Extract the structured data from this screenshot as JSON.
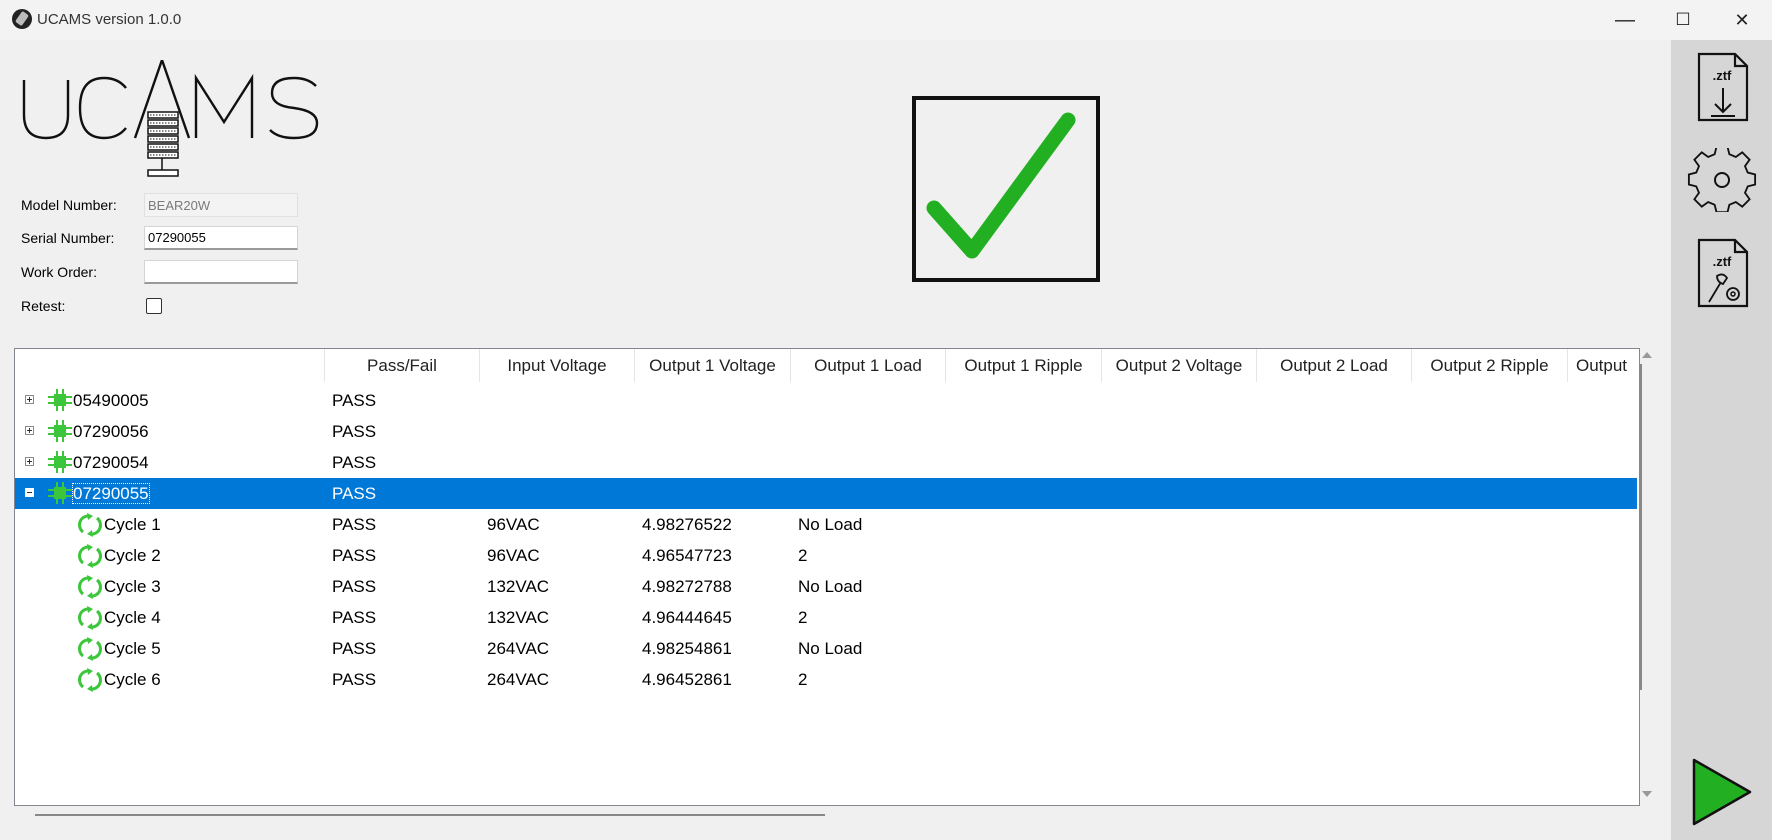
{
  "window": {
    "title": "UCAMS version 1.0.0",
    "minimize": "—",
    "maximize": "☐",
    "close": "✕"
  },
  "logo": {
    "text": "UCAMS"
  },
  "form": {
    "model_label": "Model Number:",
    "model_value": "BEAR20W",
    "serial_label": "Serial Number:",
    "serial_value": "07290055",
    "workorder_label": "Work Order:",
    "workorder_value": "",
    "retest_label": "Retest:",
    "retest_checked": false
  },
  "status": {
    "result": "pass",
    "color": "#22b022"
  },
  "grid": {
    "columns": [
      "",
      "Pass/Fail",
      "Input Voltage",
      "Output 1 Voltage",
      "Output 1 Load",
      "Output 1 Ripple",
      "Output 2 Voltage",
      "Output 2 Load",
      "Output 2 Ripple",
      "Output"
    ],
    "units": [
      {
        "serial": "05490005",
        "result": "PASS",
        "expanded": false
      },
      {
        "serial": "07290056",
        "result": "PASS",
        "expanded": false
      },
      {
        "serial": "07290054",
        "result": "PASS",
        "expanded": false
      },
      {
        "serial": "07290055",
        "result": "PASS",
        "expanded": true,
        "selected": true
      }
    ],
    "cycles": [
      {
        "name": "Cycle 1",
        "result": "PASS",
        "input_voltage": "96VAC",
        "output1_voltage": "4.98276522",
        "output1_load": "No Load"
      },
      {
        "name": "Cycle 2",
        "result": "PASS",
        "input_voltage": "96VAC",
        "output1_voltage": "4.96547723",
        "output1_load": "2"
      },
      {
        "name": "Cycle 3",
        "result": "PASS",
        "input_voltage": "132VAC",
        "output1_voltage": "4.98272788",
        "output1_load": "No Load"
      },
      {
        "name": "Cycle 4",
        "result": "PASS",
        "input_voltage": "132VAC",
        "output1_voltage": "4.96444645",
        "output1_load": "2"
      },
      {
        "name": "Cycle 5",
        "result": "PASS",
        "input_voltage": "264VAC",
        "output1_voltage": "4.98254861",
        "output1_load": "No Load"
      },
      {
        "name": "Cycle 6",
        "result": "PASS",
        "input_voltage": "264VAC",
        "output1_voltage": "4.96452861",
        "output1_load": "2"
      }
    ]
  },
  "sidebar": {
    "download_label": ".ztf",
    "config_label": ".ztf",
    "icons": [
      "ztf-download-icon",
      "gear-icon",
      "ztf-config-icon",
      "play-icon"
    ],
    "play_color": "#22b022"
  }
}
